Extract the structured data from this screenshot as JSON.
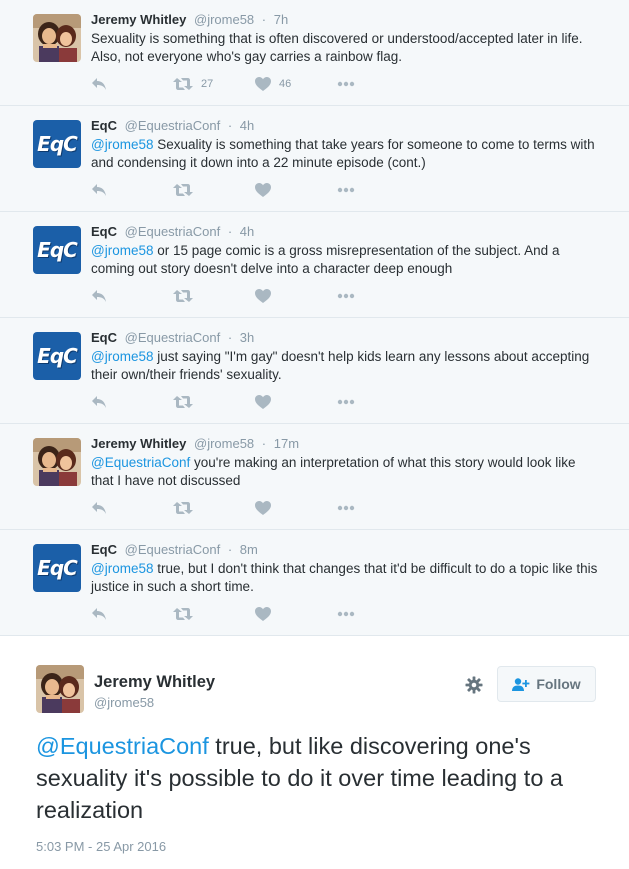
{
  "thread": [
    {
      "avatar": "jeremy-avatar",
      "name": "Jeremy Whitley",
      "handle": "@jrome58",
      "time": "7h",
      "mention": "",
      "text": "Sexuality is something that is often discovered or understood/accepted later in life. Also, not everyone who's gay carries a rainbow flag.",
      "retweets": "27",
      "likes": "46"
    },
    {
      "avatar": "eqc-avatar",
      "name": "EqC",
      "handle": "@EquestriaConf",
      "time": "4h",
      "mention": "@jrome58",
      "text": " Sexuality is something that take years for someone to come to terms with and condensing it down into a 22 minute episode (cont.)",
      "retweets": "",
      "likes": ""
    },
    {
      "avatar": "eqc-avatar",
      "name": "EqC",
      "handle": "@EquestriaConf",
      "time": "4h",
      "mention": "@jrome58",
      "text": " or 15 page comic is a gross misrepresentation of the subject. And a coming out story doesn't delve into a character deep enough",
      "retweets": "",
      "likes": ""
    },
    {
      "avatar": "eqc-avatar",
      "name": "EqC",
      "handle": "@EquestriaConf",
      "time": "3h",
      "mention": "@jrome58",
      "text": " just saying \"I'm gay\" doesn't help kids learn any lessons about accepting their own/their friends' sexuality.",
      "retweets": "",
      "likes": ""
    },
    {
      "avatar": "jeremy-avatar",
      "name": "Jeremy Whitley",
      "handle": "@jrome58",
      "time": "17m",
      "mention": "@EquestriaConf",
      "text": " you're making an interpretation of what this story would look like that I have not discussed",
      "retweets": "",
      "likes": ""
    },
    {
      "avatar": "eqc-avatar",
      "name": "EqC",
      "handle": "@EquestriaConf",
      "time": "8m",
      "mention": "@jrome58",
      "text": " true, but I don't think that changes that it'd be difficult to do a topic like this justice in such a short time.",
      "retweets": "",
      "likes": ""
    }
  ],
  "avatar_logo_text": "EqC",
  "separator": "·",
  "main_tweet": {
    "name": "Jeremy Whitley",
    "handle": "@jrome58",
    "follow_label": "Follow",
    "mention": "@EquestriaConf",
    "text": " true, but like discovering one's sexuality it's possible to do it over time leading to a realization",
    "timestamp": "5:03 PM - 25 Apr 2016"
  },
  "colors": {
    "link": "#1b95e0",
    "icon": "#aab8c2",
    "muted": "#8899a6",
    "text": "#292f33",
    "eqc_brand": "#1b5fa8"
  },
  "icons": {
    "reply": "reply-icon",
    "retweet": "retweet-icon",
    "like": "heart-icon",
    "more": "more-icon",
    "settings": "gear-icon",
    "follow": "add-user-icon"
  }
}
